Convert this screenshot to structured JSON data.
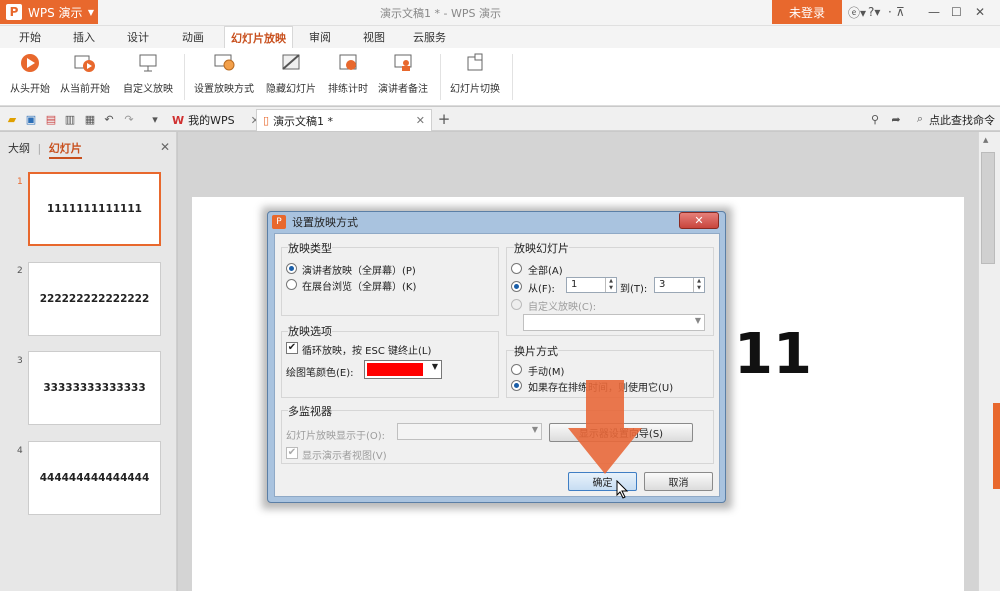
{
  "titlebar": {
    "app_name": "WPS 演示",
    "window_title": "演示文稿1 * - WPS 演示",
    "login_label": "未登录"
  },
  "ribbon_tabs": [
    "开始",
    "插入",
    "设计",
    "动画",
    "幻灯片放映",
    "审阅",
    "视图",
    "云服务"
  ],
  "ribbon": {
    "from_start": "从头开始",
    "from_current": "从当前开始",
    "custom_show": "自定义放映",
    "setup_show": "设置放映方式",
    "hide_slide": "隐藏幻灯片",
    "rehearse": "排练计时",
    "presenter_notes": "演讲者备注",
    "slide_transition": "幻灯片切换"
  },
  "doc_tabs": {
    "my_wps": "我的WPS",
    "doc": "演示文稿1 *",
    "search": "点此查找命令"
  },
  "left_pane": {
    "tab_outline": "大纲",
    "tab_slides": "幻灯片",
    "slides": [
      {
        "num": "1",
        "text": "1111111111111"
      },
      {
        "num": "2",
        "text": "222222222222222"
      },
      {
        "num": "3",
        "text": "33333333333333"
      },
      {
        "num": "4",
        "text": "444444444444444"
      }
    ]
  },
  "slide": {
    "text": "11"
  },
  "dialog": {
    "title": "设置放映方式",
    "show_type_title": "放映类型",
    "show_type_presenter": "演讲者放映（全屏幕）(P)",
    "show_type_kiosk": "在展台浏览（全屏幕）(K)",
    "show_slides_title": "放映幻灯片",
    "all": "全部(A)",
    "from": "从(F):",
    "from_value": "1",
    "to": "到(T):",
    "to_value": "3",
    "custom": "自定义放映(C):",
    "options_title": "放映选项",
    "loop": "循环放映，按 ESC 键终止(L)",
    "pen_color": "绘图笔颜色(E):",
    "pen_color_value": "#ff0000",
    "advance_title": "换片方式",
    "manual": "手动(M)",
    "use_timings": "如果存在排练时间，则使用它(U)",
    "multi_title": "多监视器",
    "show_on": "幻灯片放映显示于(O):",
    "wizard": "显示器设置向导(S)",
    "presenter_view": "显示演示者视图(V)",
    "ok": "确定",
    "cancel": "取消"
  }
}
